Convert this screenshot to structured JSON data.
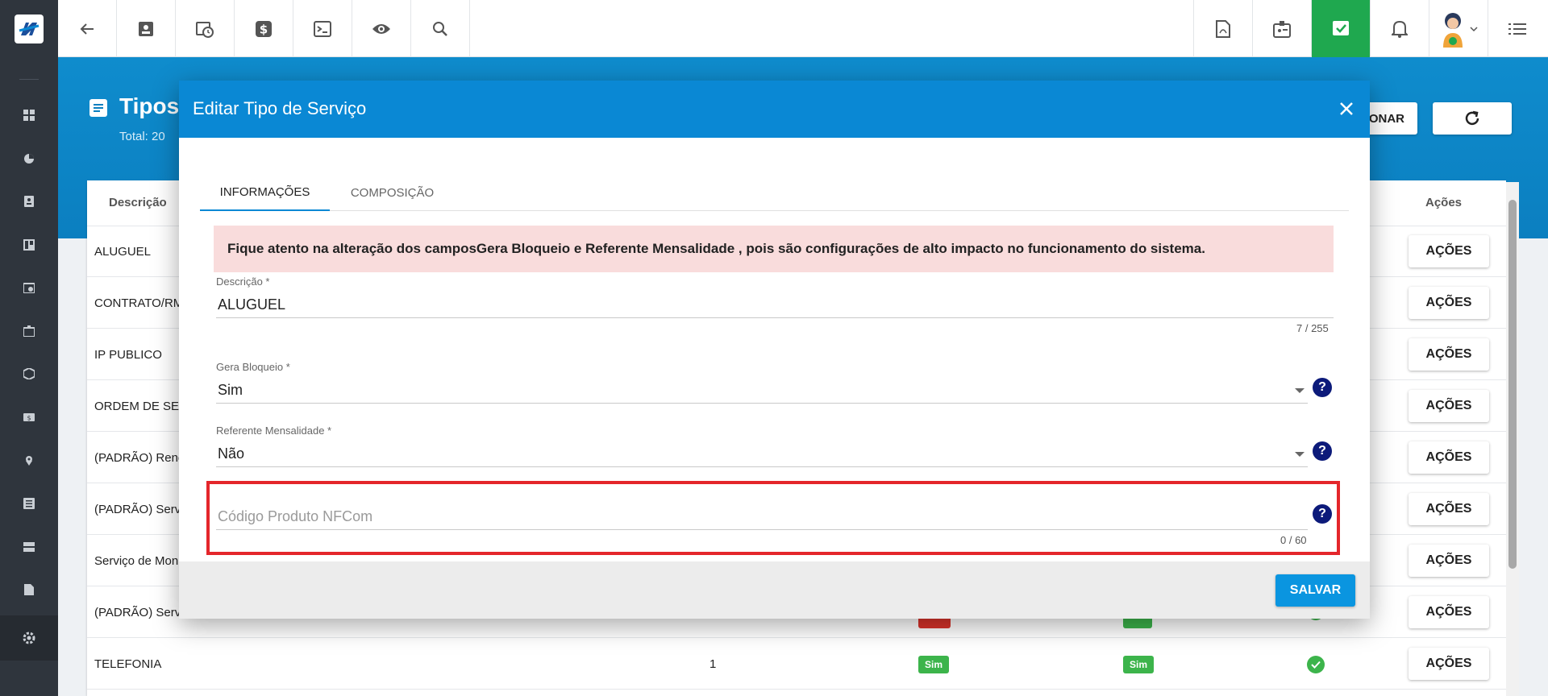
{
  "topbar": {
    "left_icons": [
      "back-arrow-icon",
      "contact-card-icon",
      "calendar-clock-icon",
      "dollar-icon",
      "terminal-icon",
      "eye-icon",
      "search-icon"
    ],
    "right_icons": [
      "pdf-icon",
      "badge-icon",
      "checklist-icon",
      "bell-icon",
      "user-avatar",
      "menu-list-icon"
    ],
    "accent": "#1fa84f"
  },
  "sidebar": {
    "icons": [
      "dashboard-icon",
      "pie-chart-icon",
      "contacts-icon",
      "board-icon",
      "calendar-icon",
      "badge-icon",
      "box-icon",
      "money-icon",
      "location-icon",
      "list-icon",
      "server-icon",
      "document-icon",
      "settings-icon"
    ]
  },
  "page": {
    "title": "Tipos",
    "total": "Total: 20",
    "add_button": "CIONAR",
    "refresh_icon": "refresh-icon"
  },
  "table": {
    "headers": {
      "descricao": "Descrição",
      "acoes": "Ações"
    },
    "rows": [
      {
        "desc": "ALUGUEL",
        "action": "AÇÕES"
      },
      {
        "desc": "CONTRATO/RMI",
        "action": "AÇÕES"
      },
      {
        "desc": "IP PUBLICO",
        "action": "AÇÕES"
      },
      {
        "desc": "ORDEM DE SERV",
        "action": "AÇÕES"
      },
      {
        "desc": "(PADRÃO) Reneg",
        "action": "AÇÕES"
      },
      {
        "desc": "(PADRÃO) Servic",
        "action": "AÇÕES"
      },
      {
        "desc": "Serviço de Moni",
        "action": "AÇÕES"
      },
      {
        "desc": "(PADRÃO) Serviç",
        "action": "AÇÕES"
      },
      {
        "desc": "TELEFONIA",
        "qty": "1",
        "badge1": "Sim",
        "badge2": "Sim",
        "action": "AÇÕES"
      }
    ]
  },
  "modal": {
    "title": "Editar Tipo de Serviço",
    "tabs": [
      "INFORMAÇÕES",
      "COMPOSIÇÃO"
    ],
    "alert": {
      "prefix": "Fique atento na alteração dos campos ",
      "field1": "Gera Bloqueio",
      "mid": " e ",
      "field2": "Referente Mensalidade",
      "suffix": " , pois são configurações de alto impacto no funcionamento do sistema."
    },
    "fields": {
      "descricao": {
        "label": "Descrição *",
        "value": "ALUGUEL",
        "count": "7 / 255"
      },
      "gera_bloqueio": {
        "label": "Gera Bloqueio *",
        "value": "Sim"
      },
      "referente_mensalidade": {
        "label": "Referente Mensalidade *",
        "value": "Não"
      },
      "codigo_nfcom": {
        "placeholder": "Código Produto NFCom",
        "count": "0 / 60"
      }
    },
    "help_glyph": "?",
    "save": "SALVAR"
  }
}
